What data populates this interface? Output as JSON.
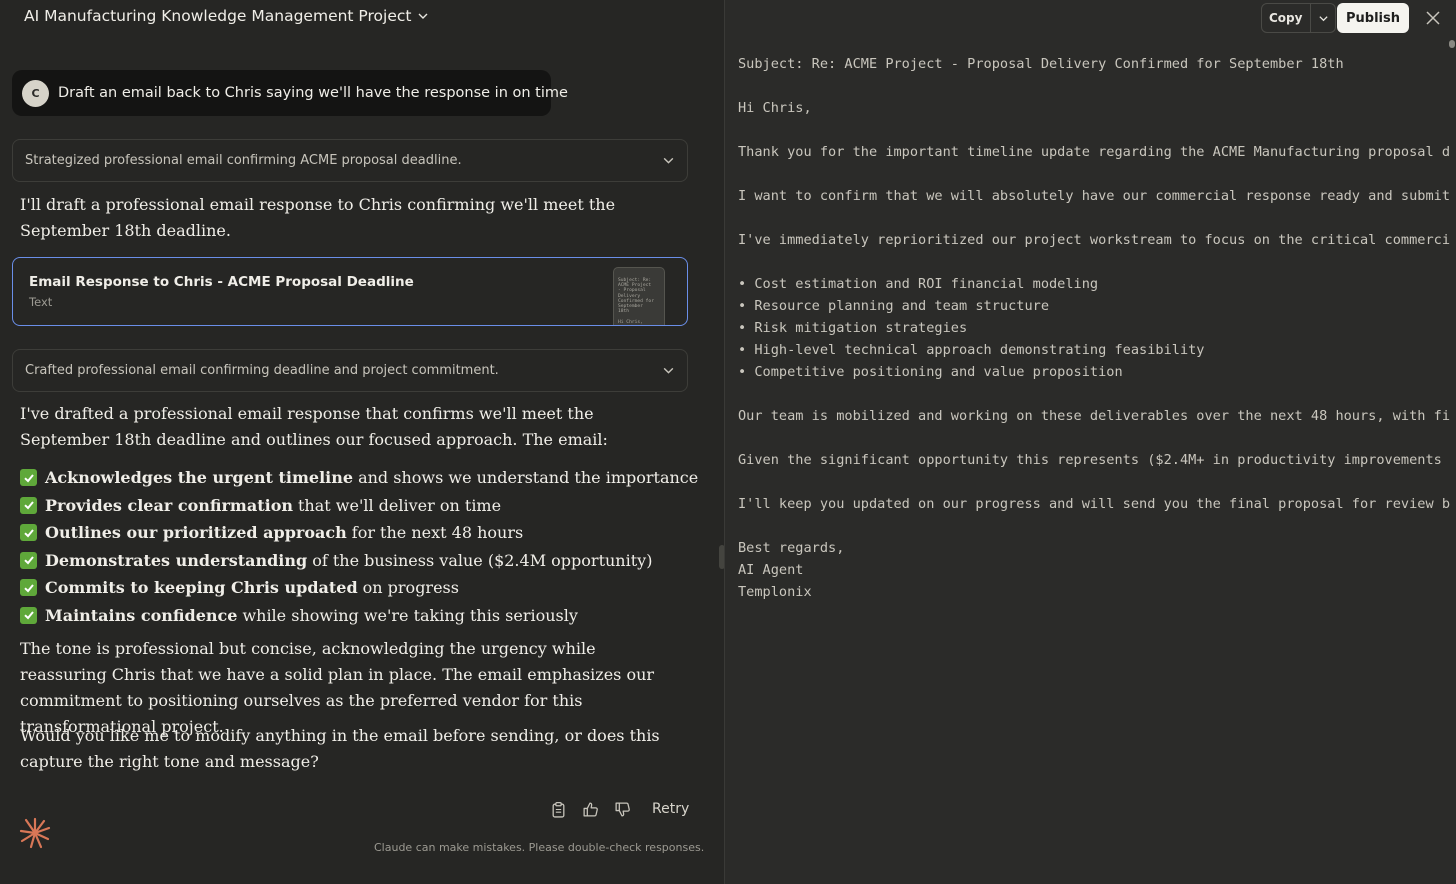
{
  "header": {
    "project_title": "AI Manufacturing Knowledge Management Project"
  },
  "user_message": {
    "avatar_initial": "C",
    "text": "Draft an email back to Chris saying we'll have the response in on time"
  },
  "thinking": [
    "Strategized professional email confirming ACME proposal deadline.",
    "Crafted professional email confirming deadline and project commitment."
  ],
  "intro_text": "I'll draft a professional email response to Chris confirming we'll meet the September 18th deadline.",
  "artifact": {
    "title": "Email Response to Chris - ACME Proposal Deadline",
    "type": "Text",
    "thumb_text": "Subject: Re:\nACME Project\n- Proposal\nDelivery\nConfirmed for\nSeptember\n18th\n\nHi Chris,"
  },
  "summary_text": "I've drafted a professional email response that confirms we'll meet the September 18th deadline and outlines our focused approach. The email:",
  "checklist": [
    {
      "bold": "Acknowledges the urgent timeline",
      "rest": "and shows we understand the importance"
    },
    {
      "bold": "Provides clear confirmation",
      "rest": "that we'll deliver on time"
    },
    {
      "bold": "Outlines our prioritized approach",
      "rest": "for the next 48 hours"
    },
    {
      "bold": "Demonstrates understanding",
      "rest": "of the business value ($2.4M opportunity)"
    },
    {
      "bold": "Commits to keeping Chris updated",
      "rest": "on progress"
    },
    {
      "bold": "Maintains confidence",
      "rest": "while showing we're taking this seriously"
    }
  ],
  "tone_text": "The tone is professional but concise, acknowledging the urgency while reassuring Chris that we have a solid plan in place. The email emphasizes our commitment to positioning ourselves as the preferred vendor for this transformational project.",
  "question_text": "Would you like me to modify anything in the email before sending, or does this capture the right tone and message?",
  "actions": {
    "retry_label": "Retry"
  },
  "disclaimer": "Claude can make mistakes. Please double-check responses.",
  "panel": {
    "copy_label": "Copy",
    "publish_label": "Publish",
    "email_lines": [
      "Subject: Re: ACME Project - Proposal Delivery Confirmed for September 18th",
      "",
      "Hi Chris,",
      "",
      "Thank you for the important timeline update regarding the ACME Manufacturing proposal d",
      "",
      "I want to confirm that we will absolutely have our commercial response ready and submit",
      "",
      "I've immediately reprioritized our project workstream to focus on the critical commerci",
      "",
      "• Cost estimation and ROI financial modeling",
      "• Resource planning and team structure",
      "• Risk mitigation strategies",
      "• High-level technical approach demonstrating feasibility",
      "• Competitive positioning and value proposition",
      "",
      "Our team is mobilized and working on these deliverables over the next 48 hours, with fi",
      "",
      "Given the significant opportunity this represents ($2.4M+ in productivity improvements",
      "",
      "I'll keep you updated on our progress and will send you the final proposal for review b",
      "",
      "Best regards,",
      "AI Agent",
      "Templonix"
    ]
  },
  "colors": {
    "accent_border": "#6a8ee8",
    "check_green": "#5fa83a",
    "logo": "#d97757"
  }
}
